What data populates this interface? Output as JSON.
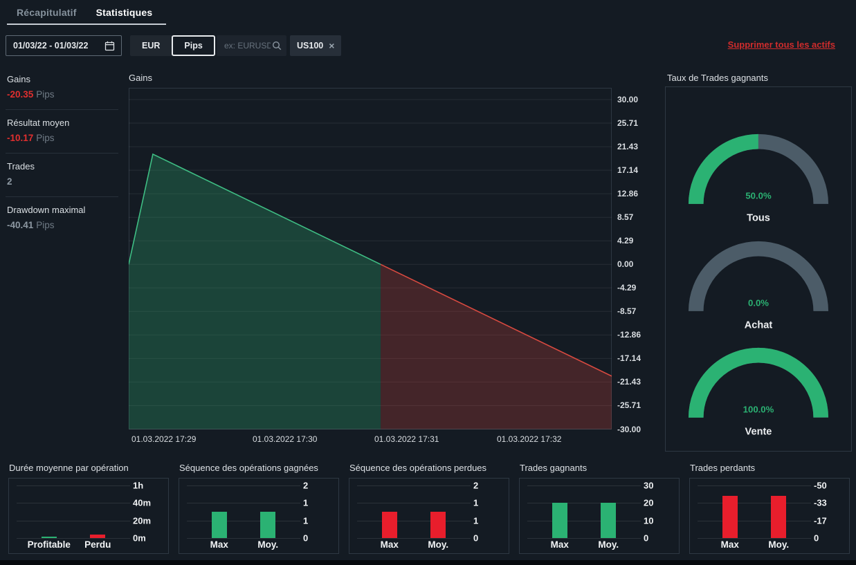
{
  "header": {
    "tabs": [
      {
        "label": "Récapitulatif",
        "active": false
      },
      {
        "label": "Statistiques",
        "active": true
      }
    ]
  },
  "filters": {
    "date_range_value": "01/03/22 - 01/03/22",
    "unit_toggle": {
      "options": [
        "EUR",
        "Pips"
      ],
      "selected": "Pips"
    },
    "search_placeholder": "ex: EURUSD",
    "asset_chips": [
      {
        "label": "US100"
      }
    ],
    "remove_all_link": "Supprimer tous les actifs"
  },
  "summary_stats": [
    {
      "label": "Gains",
      "value": "-20.35",
      "unit": "Pips",
      "value_color": "red"
    },
    {
      "label": "Résultat moyen",
      "value": "-10.17",
      "unit": "Pips",
      "value_color": "red"
    },
    {
      "label": "Trades",
      "value": "2",
      "unit": "",
      "value_color": "gray"
    },
    {
      "label": "Drawdown maximal",
      "value": "-40.41",
      "unit": "Pips",
      "value_color": "gray"
    }
  ],
  "colors": {
    "green": "#2bb273",
    "red_bar": "#e81e2c",
    "green_line": "#3fbe84",
    "red_line": "#d94a40",
    "green_fill": "rgba(46,165,110,0.30)",
    "red_fill": "rgba(222,72,62,0.24)",
    "gauge_gray": "#4c5c68",
    "negative_text": "#e12f2f",
    "link_red": "#cf2c2c"
  },
  "chart_data": [
    {
      "id": "gains",
      "type": "area",
      "title": "Gains",
      "ylabel_unit": "Pips",
      "ylim": [
        -30,
        30
      ],
      "y_tick_labels": [
        "30.00",
        "25.71",
        "21.43",
        "17.14",
        "12.86",
        "8.57",
        "4.29",
        "0.00",
        "-4.29",
        "-8.57",
        "-12.86",
        "-17.14",
        "-21.43",
        "-25.71",
        "-30.00"
      ],
      "x_tick_labels": [
        "01.03.2022 17:29",
        "01.03.2022 17:30",
        "01.03.2022 17:31",
        "01.03.2022 17:32"
      ],
      "x_tick_pos": [
        0.006,
        0.257,
        0.509,
        0.762
      ],
      "series_points": [
        [
          0,
          0
        ],
        [
          0.05,
          20.06
        ],
        [
          1,
          -20.35
        ]
      ],
      "grid": true,
      "note": "cumulative gains in Pips; area green above 0, red below 0"
    },
    {
      "id": "win_rate",
      "type": "gauge",
      "title": "Taux de Trades gagnants",
      "items": [
        {
          "label": "Tous",
          "value_pct": 50.0,
          "display": "50.0%"
        },
        {
          "label": "Achat",
          "value_pct": 0.0,
          "display": "0.0%"
        },
        {
          "label": "Vente",
          "value_pct": 100.0,
          "display": "100.0%"
        }
      ]
    },
    {
      "id": "avg_duration",
      "type": "bar",
      "title": "Durée moyenne par opération",
      "categories": [
        "Profitable",
        "Perdu"
      ],
      "values": [
        2,
        4
      ],
      "value_unit": "minutes",
      "ymax": 60,
      "y_tick_labels": [
        "1h",
        "40m",
        "20m",
        "0m"
      ],
      "bar_colors": [
        "green",
        "red"
      ]
    },
    {
      "id": "win_streak",
      "type": "bar",
      "title": "Séquence des opérations gagnées",
      "categories": [
        "Max",
        "Moy."
      ],
      "values": [
        1,
        1
      ],
      "ymax": 2,
      "y_tick_labels": [
        "2",
        "1",
        "1",
        "0"
      ],
      "bar_colors": [
        "green",
        "green"
      ]
    },
    {
      "id": "loss_streak",
      "type": "bar",
      "title": "Séquence des opérations perdues",
      "categories": [
        "Max",
        "Moy."
      ],
      "values": [
        1,
        1
      ],
      "ymax": 2,
      "y_tick_labels": [
        "2",
        "1",
        "1",
        "0"
      ],
      "bar_colors": [
        "red",
        "red"
      ]
    },
    {
      "id": "winning_trades",
      "type": "bar",
      "title": "Trades gagnants",
      "categories": [
        "Max",
        "Moy."
      ],
      "values": [
        20.06,
        20.06
      ],
      "value_unit": "Pips",
      "ymax": 30,
      "y_tick_labels": [
        "30",
        "20",
        "10",
        "0"
      ],
      "bar_colors": [
        "green",
        "green"
      ]
    },
    {
      "id": "losing_trades",
      "type": "bar",
      "title": "Trades perdants",
      "categories": [
        "Max",
        "Moy."
      ],
      "values": [
        -40.41,
        -40.41
      ],
      "value_unit": "Pips",
      "ymax": 50,
      "y_tick_labels": [
        "-50",
        "-33",
        "-17",
        "0"
      ],
      "bar_colors": [
        "red",
        "red"
      ]
    }
  ]
}
